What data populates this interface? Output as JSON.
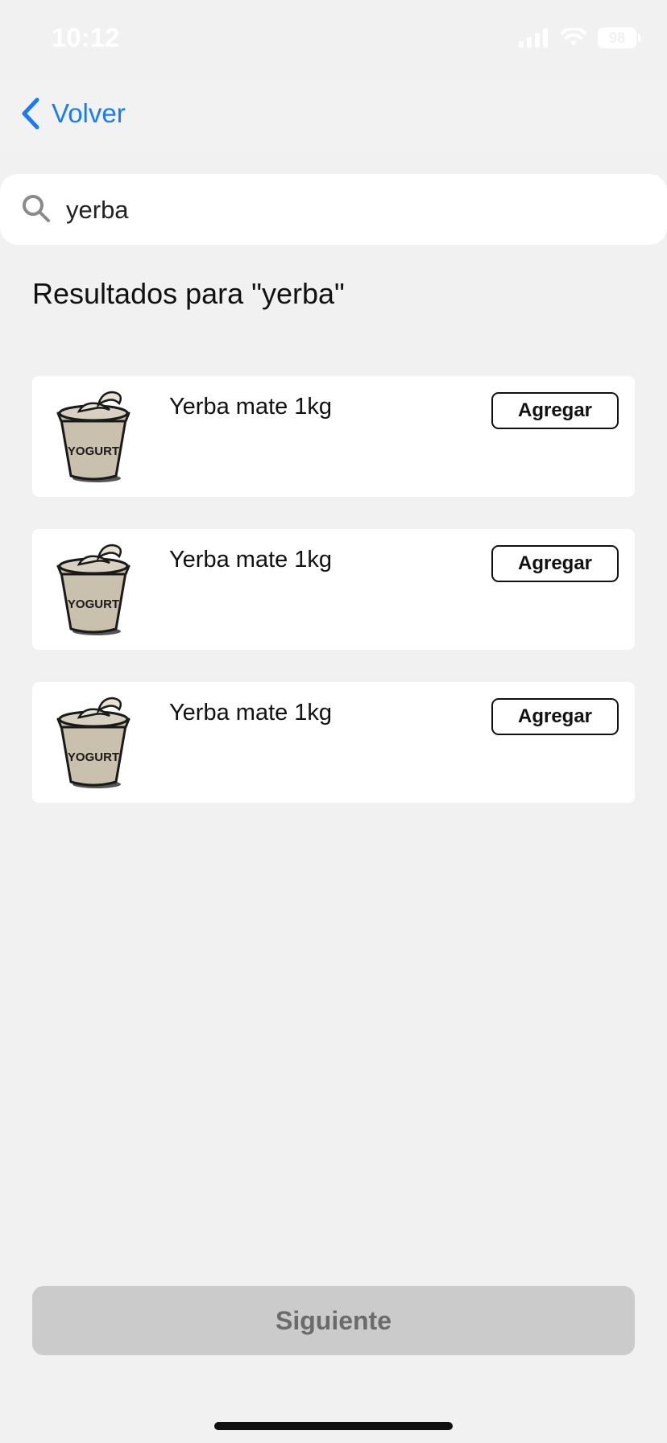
{
  "status_bar": {
    "time": "10:12",
    "battery": "98"
  },
  "nav": {
    "back_label": "Volver"
  },
  "search": {
    "value": "yerba",
    "placeholder": ""
  },
  "results": {
    "title": "Resultados para \"yerba\"",
    "items": [
      {
        "name": "Yerba mate 1kg",
        "image_label": "YOGURT",
        "button": "Agregar"
      },
      {
        "name": "Yerba mate 1kg",
        "image_label": "YOGURT",
        "button": "Agregar"
      },
      {
        "name": "Yerba mate 1kg",
        "image_label": "YOGURT",
        "button": "Agregar"
      }
    ]
  },
  "footer": {
    "next_label": "Siguiente"
  },
  "colors": {
    "accent": "#1a7cf4",
    "background": "#f1f1f1",
    "disabled_button": "#cbcbcb"
  },
  "icons": {
    "search": "search-icon",
    "back": "chevron-left-icon",
    "product": "yogurt-cup-icon"
  }
}
